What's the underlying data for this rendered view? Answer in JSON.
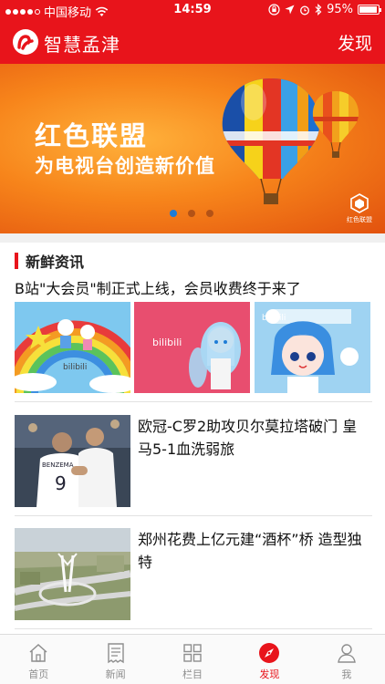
{
  "status_bar": {
    "carrier": "中国移动",
    "time": "14:59",
    "battery": "95%",
    "battery_level": 0.95
  },
  "header": {
    "app_name": "智慧孟津",
    "discover_label": "发现"
  },
  "banner": {
    "headline": "红色联盟",
    "subline": "为电视台创造新价值",
    "brand": "红色联盟",
    "slide_count": 3,
    "active_slide": 1
  },
  "section": {
    "title": "新鲜资讯"
  },
  "articles": [
    {
      "title": "B站\"大会员\"制正式上线，会员收费终于来了",
      "thumbnails": [
        "bilibili-rainbow",
        "bilibili-pink",
        "bilibili-blue"
      ]
    },
    {
      "title": "欧冠-C罗2助攻贝尔莫拉塔破门 皇马5-1血洗弱旅",
      "thumbnail": "football-players"
    },
    {
      "title": "郑州花费上亿元建“酒杯”桥 造型独特",
      "thumbnail": "bridge-aerial"
    }
  ],
  "thumb_text": {
    "bilibili": "bilibili",
    "jersey_name": "BENZEMA",
    "jersey_number": "9"
  },
  "tabs": [
    {
      "label": "首页",
      "icon": "home-icon"
    },
    {
      "label": "新闻",
      "icon": "news-icon"
    },
    {
      "label": "栏目",
      "icon": "grid-icon"
    },
    {
      "label": "发现",
      "icon": "compass-icon",
      "active": true
    },
    {
      "label": "我",
      "icon": "person-icon"
    }
  ],
  "colors": {
    "brand_red": "#e8141b",
    "tab_inactive": "#8e8e8e"
  }
}
